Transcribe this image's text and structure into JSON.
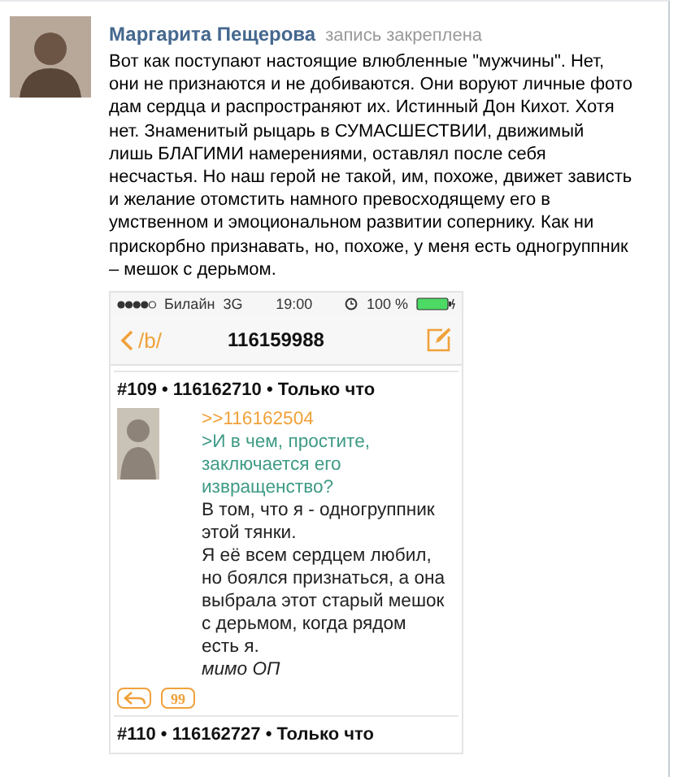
{
  "post": {
    "author": "Маргарита Пещерова",
    "note": "запись закреплена",
    "text": "Вот как поступают настоящие влюбленные \"мужчины\". Нет, они не признаются и не добиваются. Они воруют личные фото дам сердца и распространяют их. Истинный Дон Кихот. Хотя нет. Знаменитый рыцарь в СУМАСШЕСТВИИ, движимый лишь БЛАГИМИ намерениями, оставлял после себя несчастья. Но наш герой не такой, им, похоже, движет зависть и желание отомстить намного превосходящему его в умственном и эмоциональном развитии сопернику. Как ни прискорбно признавать, но, похоже, у меня есть одногруппник – мешок с дерьмом.",
    "screenshot": {
      "status_bar": {
        "carrier": "Билайн",
        "network": "3G",
        "time": "19:00",
        "battery": "100 %"
      },
      "nav": {
        "back": "/b/",
        "title": "116159988"
      },
      "replies": [
        {
          "header": "#109 • 116162710 • Только что",
          "lines": [
            {
              "kind": "link",
              "text": ">>116162504"
            },
            {
              "kind": "quote",
              "text": ">И в чем, простите, заключается его извращенство?"
            },
            {
              "kind": "plain",
              "text": "В том, что я - одногруппник этой тянки."
            },
            {
              "kind": "plain",
              "text": "Я её всем сердцем любил, но боялся признаться, а она выбрала этот старый мешок с дерьмом, когда рядом есть я."
            },
            {
              "kind": "signature",
              "text": "мимо ОП"
            }
          ],
          "quote_button": "99"
        },
        {
          "header": "#110 • 116162727 • Только что"
        }
      ]
    }
  }
}
